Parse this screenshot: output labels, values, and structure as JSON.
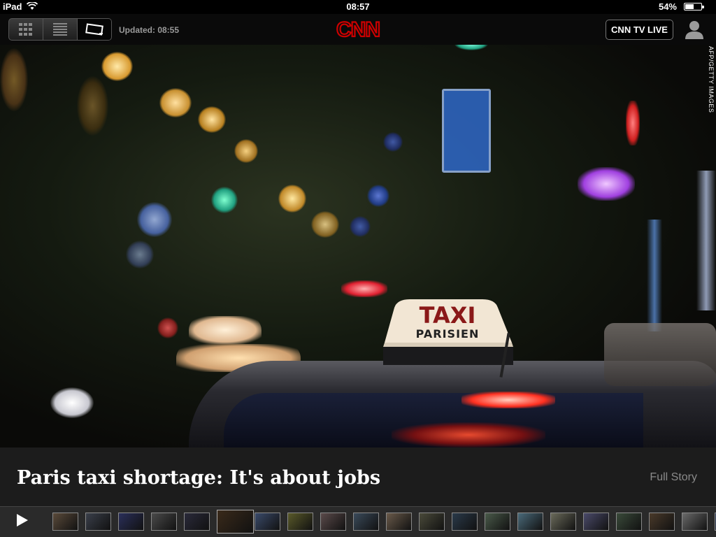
{
  "status_bar": {
    "device": "iPad",
    "time": "08:57",
    "battery": "54%",
    "battery_level": 0.54
  },
  "header": {
    "updated": "Updated: 08:55",
    "logo_text": "CNN",
    "tv_button": "CNN TV LIVE",
    "brand_color": "#cc0000",
    "view_modes": [
      "grid-view-icon",
      "list-view-icon",
      "slideshow-view-icon"
    ],
    "selected_view": "slideshow-view-icon"
  },
  "hero": {
    "credit": "AFP/GETTY IMAGES",
    "sign_line1": "TAXI",
    "sign_line2": "PARISIEN"
  },
  "story": {
    "headline": "Paris taxi shortage: It's about jobs",
    "full_story": "Full Story"
  },
  "filmstrip": {
    "play_icon": "play-icon",
    "selected_index": 5,
    "thumbnails": [
      {
        "color": "#5a4a3a"
      },
      {
        "color": "#3a3f4a"
      },
      {
        "color": "#2a2f5a"
      },
      {
        "color": "#4a4a4a"
      },
      {
        "color": "#2a2a3a"
      },
      {
        "color": "#3a2a1a"
      },
      {
        "color": "#3a4a6a"
      },
      {
        "color": "#5a5a2a"
      },
      {
        "color": "#5a4a4a"
      },
      {
        "color": "#3a4a5a"
      },
      {
        "color": "#6a5a4a"
      },
      {
        "color": "#4a4a3a"
      },
      {
        "color": "#2a3a4a"
      },
      {
        "color": "#4a5a4a"
      },
      {
        "color": "#4a6a7a"
      },
      {
        "color": "#6a6a5a"
      },
      {
        "color": "#4a4a6a"
      },
      {
        "color": "#3a4a3a"
      },
      {
        "color": "#4a3a2a"
      },
      {
        "color": "#6a6a6a"
      },
      {
        "color": "#2a3a5a"
      }
    ]
  }
}
